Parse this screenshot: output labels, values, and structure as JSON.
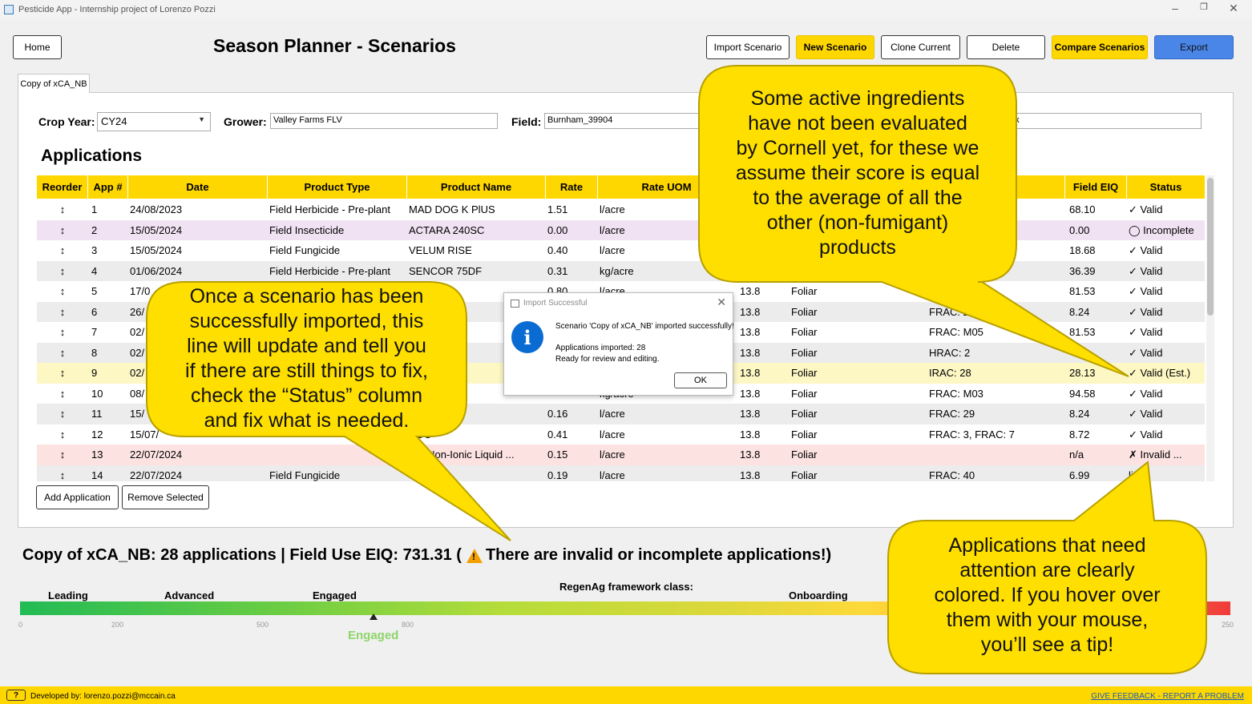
{
  "window": {
    "title": "Pesticide App - Internship project of Lorenzo Pozzi",
    "min": "–",
    "max": "❐",
    "close": "✕"
  },
  "header": {
    "home": "Home",
    "title": "Season Planner - Scenarios",
    "import": "Import Scenario",
    "new": "New Scenario",
    "clone": "Clone Current",
    "delete": "Delete",
    "compare": "Compare Scenarios",
    "export": "Export"
  },
  "tab": {
    "label": "Copy of xCA_NB"
  },
  "fields": {
    "crop_year_label": "Crop Year:",
    "crop_year_value": "CY24",
    "grower_label": "Grower:",
    "grower_value": "Valley Farms FLV",
    "field_label": "Field:",
    "field_value": "Burnham_39904",
    "extra_value": "ank"
  },
  "applications": {
    "title": "Applications",
    "columns": {
      "reorder": "Reorder",
      "app": "App #",
      "date": "Date",
      "product_type": "Product Type",
      "product_name": "Product Name",
      "rate": "Rate",
      "rate_uom": "Rate UOM",
      "s": "s",
      "field_eiq": "Field EIQ",
      "status": "Status"
    },
    "rows": [
      {
        "handle": "↕",
        "n": "1",
        "date": "24/08/2023",
        "type": "Field Herbicide - Pre-plant",
        "name": "MAD DOG K PlUS",
        "rate": "1.51",
        "uom": "l/acre",
        "ai": "",
        "method": "",
        "group": "",
        "eiq": "68.10",
        "status": "✓ Valid",
        "bg": "#ffffff"
      },
      {
        "handle": "↕",
        "n": "2",
        "date": "15/05/2024",
        "type": "Field Insecticide",
        "name": "ACTARA 240SC",
        "rate": "0.00",
        "uom": "l/acre",
        "ai": "",
        "method": "",
        "group": "",
        "eiq": "0.00",
        "status": "◯ Incomplete",
        "bg": "#f1e2f3"
      },
      {
        "handle": "↕",
        "n": "3",
        "date": "15/05/2024",
        "type": "Field Fungicide",
        "name": "VELUM RISE",
        "rate": "0.40",
        "uom": "l/acre",
        "ai": "",
        "method": "",
        "group": "",
        "eiq": "18.68",
        "status": "✓ Valid",
        "bg": "#ffffff"
      },
      {
        "handle": "↕",
        "n": "4",
        "date": "01/06/2024",
        "type": "Field Herbicide - Pre-plant",
        "name": "SENCOR 75DF",
        "rate": "0.31",
        "uom": "kg/acre",
        "ai": "",
        "method": "",
        "group": "",
        "eiq": "36.39",
        "status": "✓ Valid",
        "bg": "#ececec"
      },
      {
        "handle": "↕",
        "n": "5",
        "date": "17/0",
        "type": "",
        "name": "",
        "rate": "0.80",
        "uom": "l/acre",
        "ai": "13.8",
        "method": "Foliar",
        "group": "",
        "eiq": "81.53",
        "status": "✓ Valid",
        "bg": "#ffffff"
      },
      {
        "handle": "↕",
        "n": "6",
        "date": "26/",
        "type": "",
        "name": "0 F",
        "rate": "",
        "uom": "",
        "ai": "13.8",
        "method": "Foliar",
        "group": "FRAC: 2",
        "eiq": "8.24",
        "status": "✓ Valid",
        "bg": "#ececec"
      },
      {
        "handle": "↕",
        "n": "7",
        "date": "02/",
        "type": "",
        "name": "",
        "rate": "",
        "uom": "",
        "ai": "13.8",
        "method": "Foliar",
        "group": "FRAC: M05",
        "eiq": "81.53",
        "status": "✓ Valid",
        "bg": "#ffffff"
      },
      {
        "handle": "↕",
        "n": "8",
        "date": "02/",
        "type": "",
        "name": "",
        "rate": "",
        "uom": "",
        "ai": "13.8",
        "method": "Foliar",
        "group": "HRAC: 2",
        "eiq": "",
        "status": "✓ Valid",
        "bg": "#ececec"
      },
      {
        "handle": "↕",
        "n": "9",
        "date": "02/",
        "type": "",
        "name": "SC",
        "rate": "",
        "uom": "",
        "ai": "13.8",
        "method": "Foliar",
        "group": "IRAC: 28",
        "eiq": "28.13",
        "status": "✓ Valid (Est.)",
        "bg": "#fdf7c4"
      },
      {
        "handle": "↕",
        "n": "10",
        "date": "08/",
        "type": "",
        "name": "RO-STICK",
        "rate": "",
        "uom": "kg/acre",
        "ai": "13.8",
        "method": "Foliar",
        "group": "FRAC: M03",
        "eiq": "94.58",
        "status": "✓ Valid",
        "bg": "#ffffff"
      },
      {
        "handle": "↕",
        "n": "11",
        "date": "15/",
        "type": "",
        "name": "0 F",
        "rate": "0.16",
        "uom": "l/acre",
        "ai": "13.8",
        "method": "Foliar",
        "group": "FRAC: 29",
        "eiq": "8.24",
        "status": "✓ Valid",
        "bg": "#ececec"
      },
      {
        "handle": "↕",
        "n": "12",
        "date": "15/07/",
        "type": "",
        "name": "DUO",
        "rate": "0.41",
        "uom": "l/acre",
        "ai": "13.8",
        "method": "Foliar",
        "group": "FRAC: 3, FRAC: 7",
        "eiq": "8.72",
        "status": "✓ Valid",
        "bg": "#ffffff"
      },
      {
        "handle": "↕",
        "n": "13",
        "date": "22/07/2024",
        "type": "",
        "name": "e iii Non-Ionic Liquid ...",
        "rate": "0.15",
        "uom": "l/acre",
        "ai": "13.8",
        "method": "Foliar",
        "group": "",
        "eiq": "n/a",
        "status": "✗ Invalid ...",
        "bg": "#fde2e2"
      },
      {
        "handle": "↕",
        "n": "14",
        "date": "22/07/2024",
        "type": "Field Fungicide",
        "name": "",
        "rate": "0.19",
        "uom": "l/acre",
        "ai": "13.8",
        "method": "Foliar",
        "group": "FRAC: 40",
        "eiq": "6.99",
        "status": "lid",
        "bg": "#ececec"
      }
    ],
    "add": "Add Application",
    "remove": "Remove Selected"
  },
  "summary": {
    "text": "Copy of xCA_NB: 28 applications | Field Use EIQ: 731.31 (",
    "warning": "There are invalid or incomplete applications!)"
  },
  "framework": {
    "caption": "RegenAg framework class:",
    "bands": [
      "Leading",
      "Advanced",
      "Engaged",
      "Onboarding"
    ],
    "ticks": [
      "0",
      "200",
      "500",
      "800",
      "250"
    ],
    "current_value": 731.31,
    "current_class": "Engaged",
    "colors": {
      "start": "#22bb55",
      "mid": "#ffd93a",
      "end": "#ef3b3b"
    }
  },
  "dialog": {
    "title": "Import Successful",
    "close": "✕",
    "icon": "i",
    "line1": "Scenario 'Copy of xCA_NB' imported successfully!",
    "line2": "Applications imported: 28",
    "line3": "Ready for review and editing.",
    "ok": "OK"
  },
  "callouts": {
    "cornell": [
      "Some active ingredients",
      "have not been evaluated",
      "by Cornell yet, for these we",
      "assume their score is equal",
      "to the average of all the",
      "other (non-fumigant)",
      "products"
    ],
    "import": [
      "Once a scenario has been",
      "successfully imported, this",
      "line will update and tell you",
      "if there are still things to fix,",
      "check the “Status” column",
      "and fix what is needed."
    ],
    "attention": [
      "Applications that need",
      "attention are clearly",
      "colored. If you hover over",
      "them with your mouse,",
      "you’ll see a tip!"
    ],
    "fill": "#ffdf00"
  },
  "footer": {
    "help": "?",
    "developer": "Developed by: lorenzo.pozzi@mccain.ca",
    "feedback": "GIVE FEEDBACK - REPORT A PROBLEM"
  }
}
